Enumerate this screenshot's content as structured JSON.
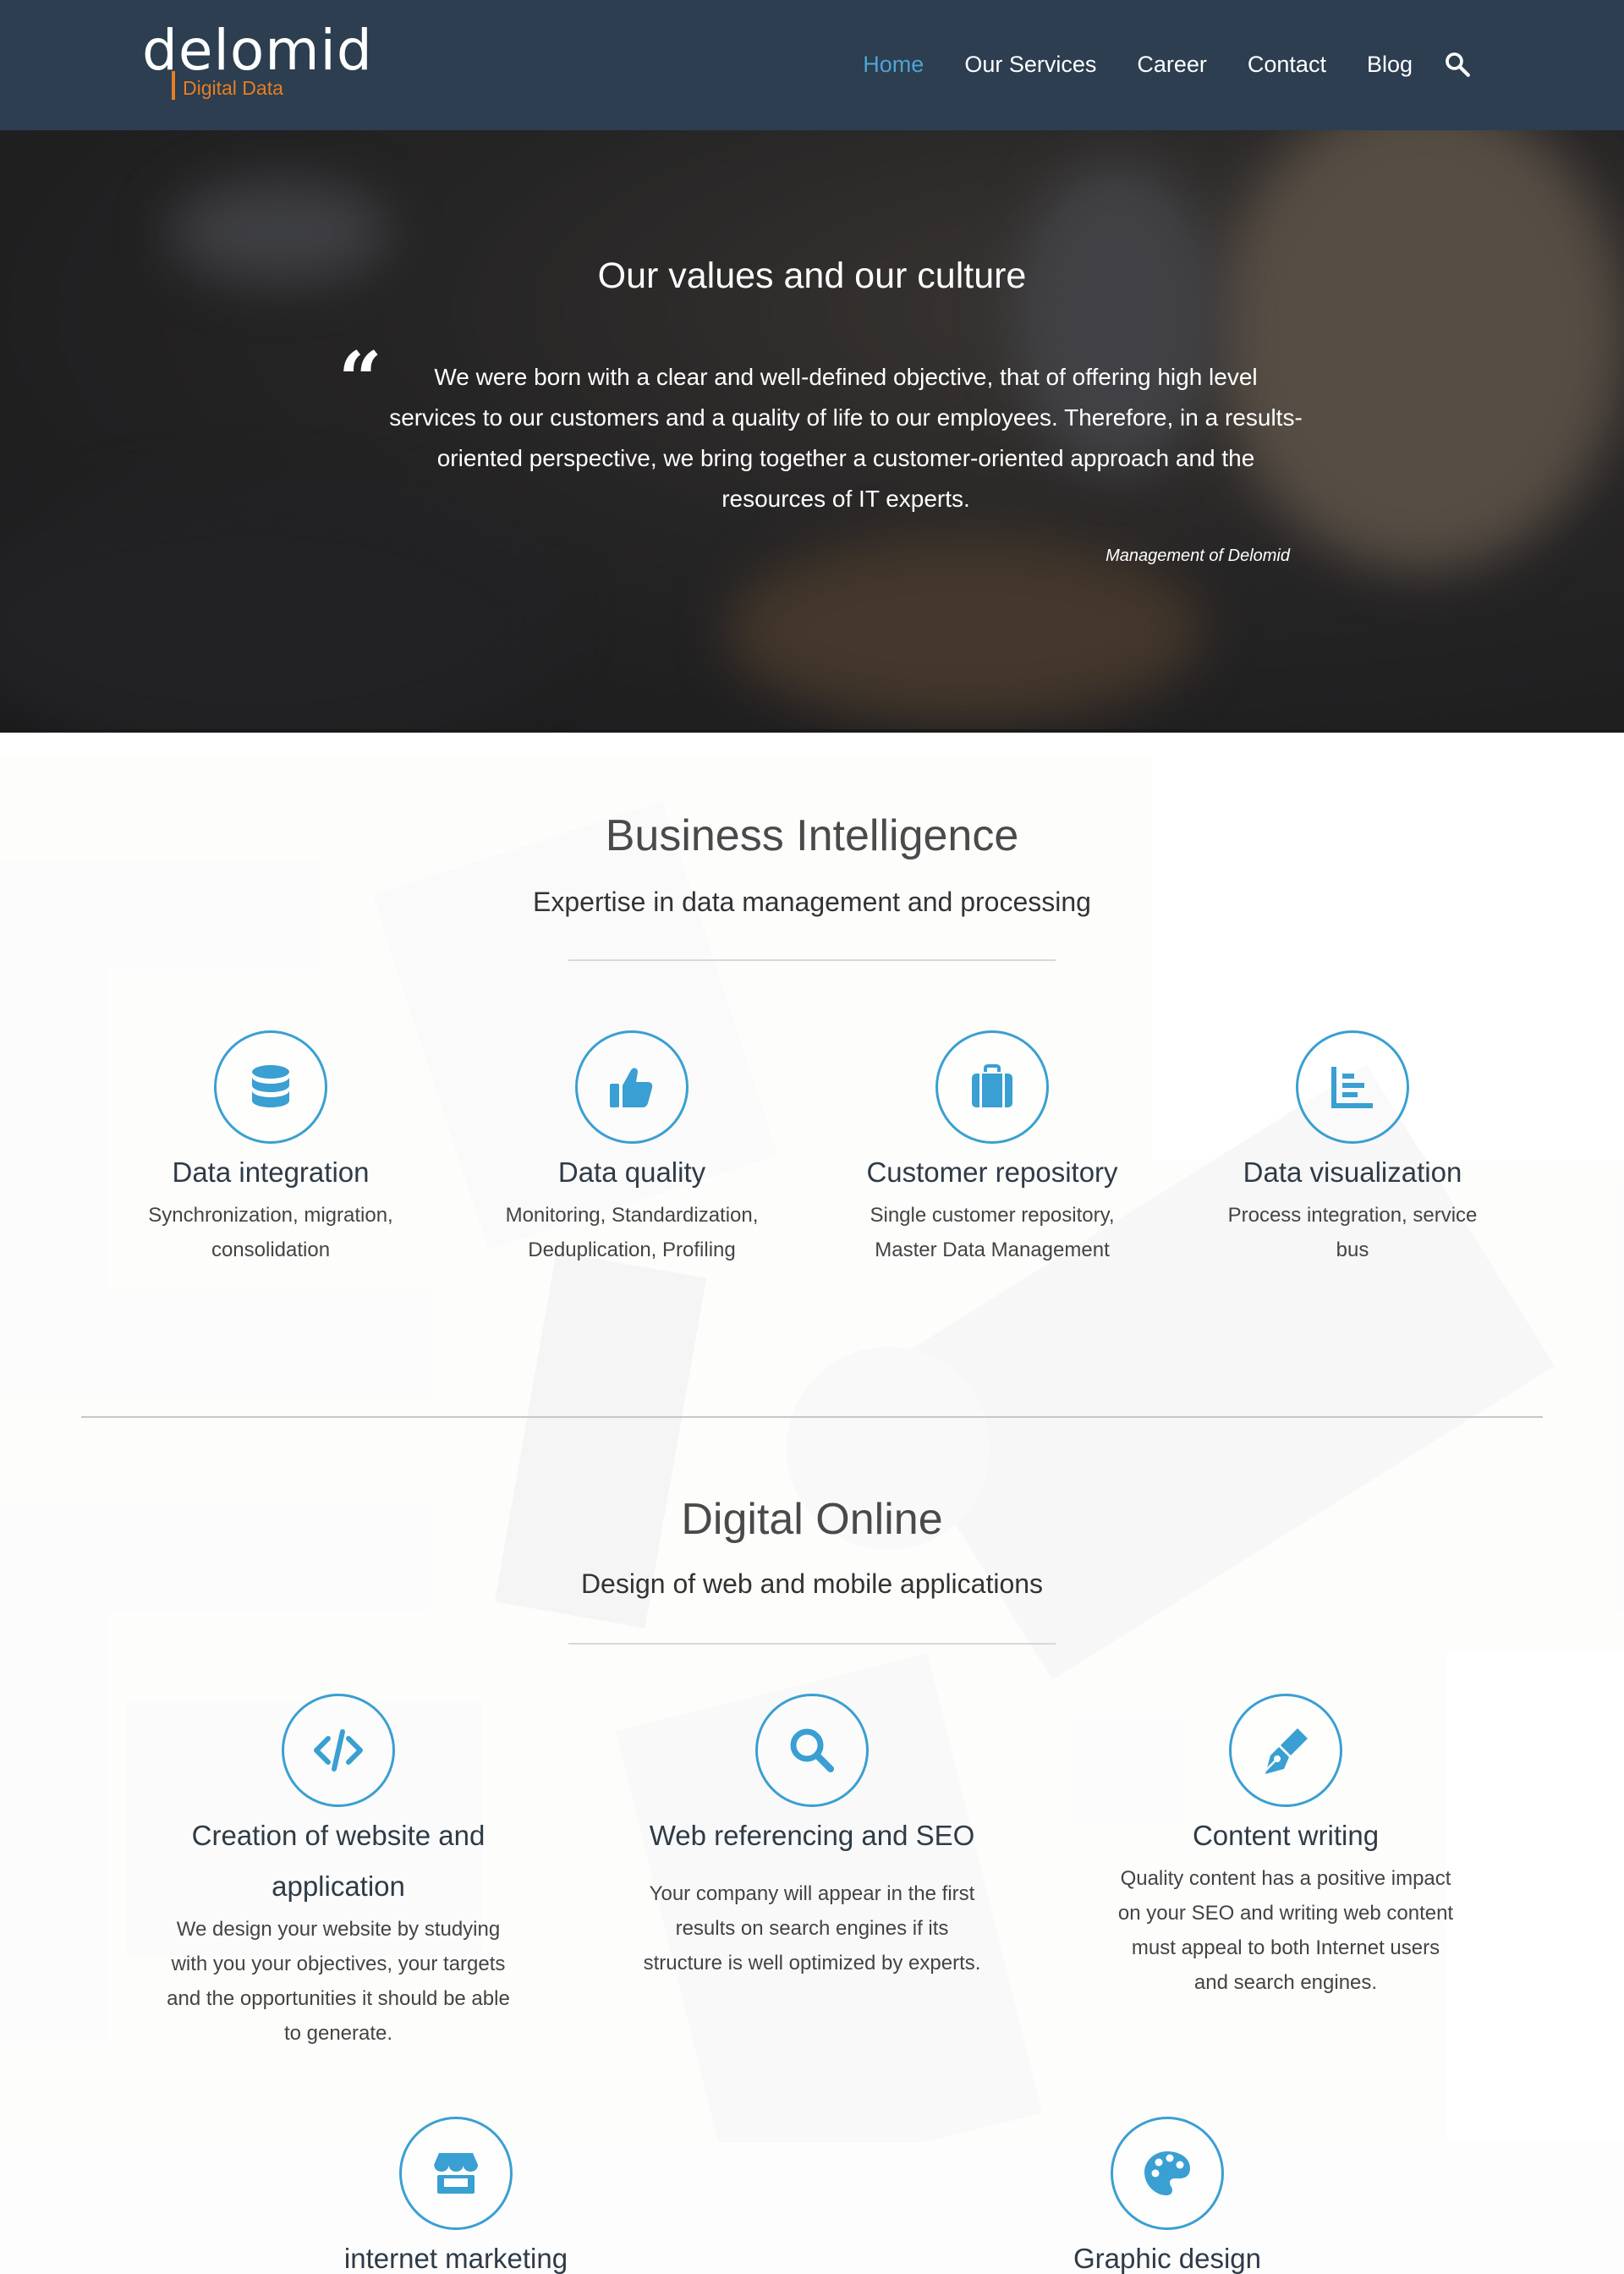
{
  "header": {
    "logo_word": "delomid",
    "logo_tagline": "Digital Data",
    "nav": [
      {
        "label": "Home",
        "active": true
      },
      {
        "label": "Our Services",
        "active": false
      },
      {
        "label": "Career",
        "active": false
      },
      {
        "label": "Contact",
        "active": false
      },
      {
        "label": "Blog",
        "active": false
      }
    ],
    "search_icon": "search-icon"
  },
  "hero": {
    "title": "Our values and our culture",
    "quote_mark": "“",
    "quote": "We were born with a clear and well-defined objective, that of offering high level services to our customers and a quality of life to our employees. Therefore, in a results-oriented perspective, we bring together a customer-oriented approach and the resources of IT experts.",
    "author": "Management of Delomid"
  },
  "bi": {
    "title": "Business Intelligence",
    "subtitle": "Expertise in data management and processing",
    "features": [
      {
        "icon": "database-icon",
        "title": "Data integration",
        "desc": "Synchronization, migration, consolidation"
      },
      {
        "icon": "thumbs-up-icon",
        "title": "Data quality",
        "desc": "Monitoring, Standardization, Deduplication, Profiling"
      },
      {
        "icon": "briefcase-icon",
        "title": "Customer repository",
        "desc": "Single customer repository, Master Data Management"
      },
      {
        "icon": "bar-chart-icon",
        "title": "Data visualization",
        "desc": "Process integration, service bus"
      }
    ]
  },
  "digital": {
    "title": "Digital Online",
    "subtitle": "Design of web and mobile applications",
    "features": [
      {
        "icon": "code-icon",
        "title": "Creation of website and application",
        "desc": "We design your website by studying with you your objectives, your targets and the opportunities it should be able to generate."
      },
      {
        "icon": "search-icon",
        "title": "Web referencing and SEO",
        "desc": "Your company will appear in the first results on search engines if its structure is well optimized by experts."
      },
      {
        "icon": "pen-nib-icon",
        "title": "Content writing",
        "desc": "Quality content has a positive impact on your SEO and writing web content must appeal to both Internet users and search engines."
      },
      {
        "icon": "store-icon",
        "title": "internet marketing",
        "desc": ""
      },
      {
        "icon": "palette-icon",
        "title": "Graphic design",
        "desc": ""
      }
    ]
  },
  "colors": {
    "header_bg": "#2c3e50",
    "nav_active": "#4ea3d6",
    "accent": "#3a9fd2",
    "logo_orange": "#e67e22"
  }
}
